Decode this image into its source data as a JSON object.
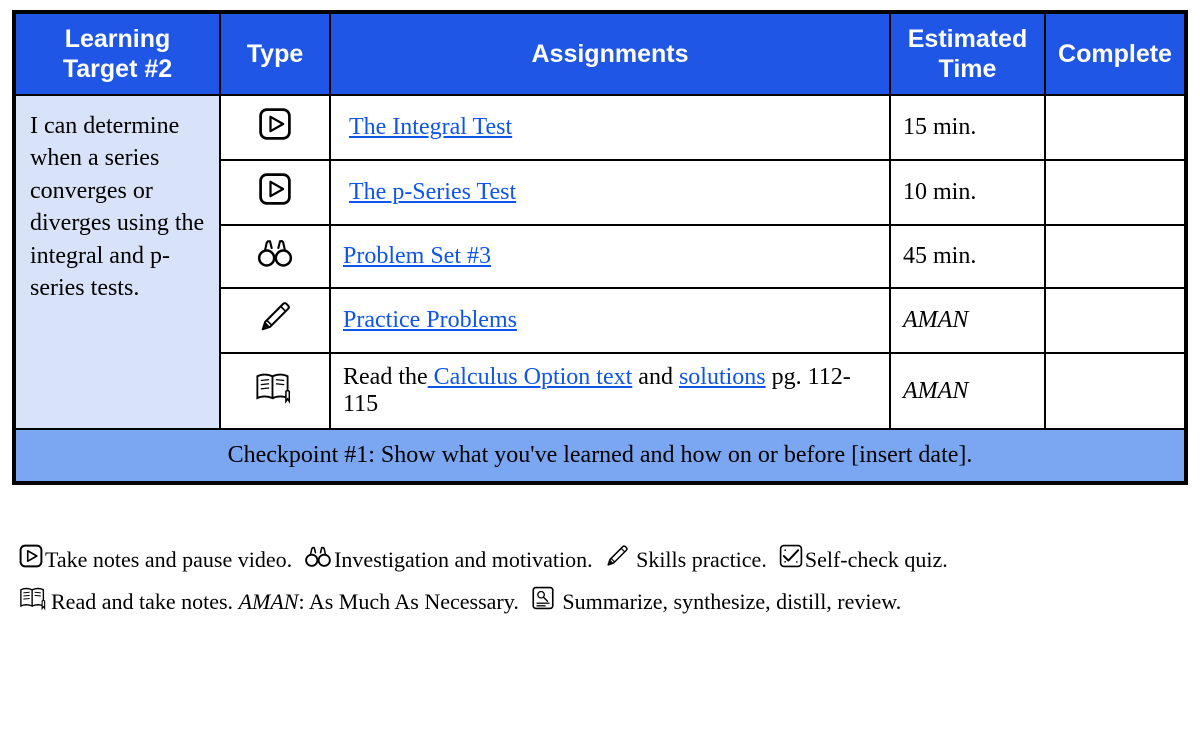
{
  "headers": {
    "target": "Learning Target #2",
    "type": "Type",
    "assignments": "Assignments",
    "time": "Estimated Time",
    "complete": "Complete"
  },
  "target_text": "I can determine when a series converges or diverges using the integral and p-series tests.",
  "rows": [
    {
      "icon": "video",
      "assignment_pre": "",
      "link1": "The Integral Test",
      "mid": "",
      "link2": "",
      "post": "",
      "time": "15 min."
    },
    {
      "icon": "video",
      "assignment_pre": "",
      "link1": "The p-Series Test",
      "mid": "",
      "link2": "",
      "post": "",
      "time": "10 min."
    },
    {
      "icon": "binoculars",
      "assignment_pre": "",
      "link1": "Problem Set #3",
      "mid": "",
      "link2": "",
      "post": "",
      "time": "45 min."
    },
    {
      "icon": "pencil",
      "assignment_pre": "",
      "link1": "Practice Problems",
      "mid": "",
      "link2": "",
      "post": "",
      "time": "AMAN",
      "time_italic": true
    },
    {
      "icon": "readnotes",
      "assignment_pre": "Read the",
      "link1": " Calculus Option text",
      "mid": " and ",
      "link2": "solutions",
      "post": " pg. 112-115",
      "time": "AMAN",
      "time_italic": true
    }
  ],
  "checkpoint": "Checkpoint #1: Show what you've learned and how on or before [insert date].",
  "legend": {
    "video": "Take notes and pause video.",
    "binoculars": "Investigation and motivation.",
    "pencil": "Skills practice.",
    "checkquiz": "Self-check quiz.",
    "readnotes": "Read and take notes.",
    "aman_label": "AMAN",
    "aman_text": ": As Much As Necessary.",
    "summarize": "Summarize, synthesize, distill, review."
  }
}
